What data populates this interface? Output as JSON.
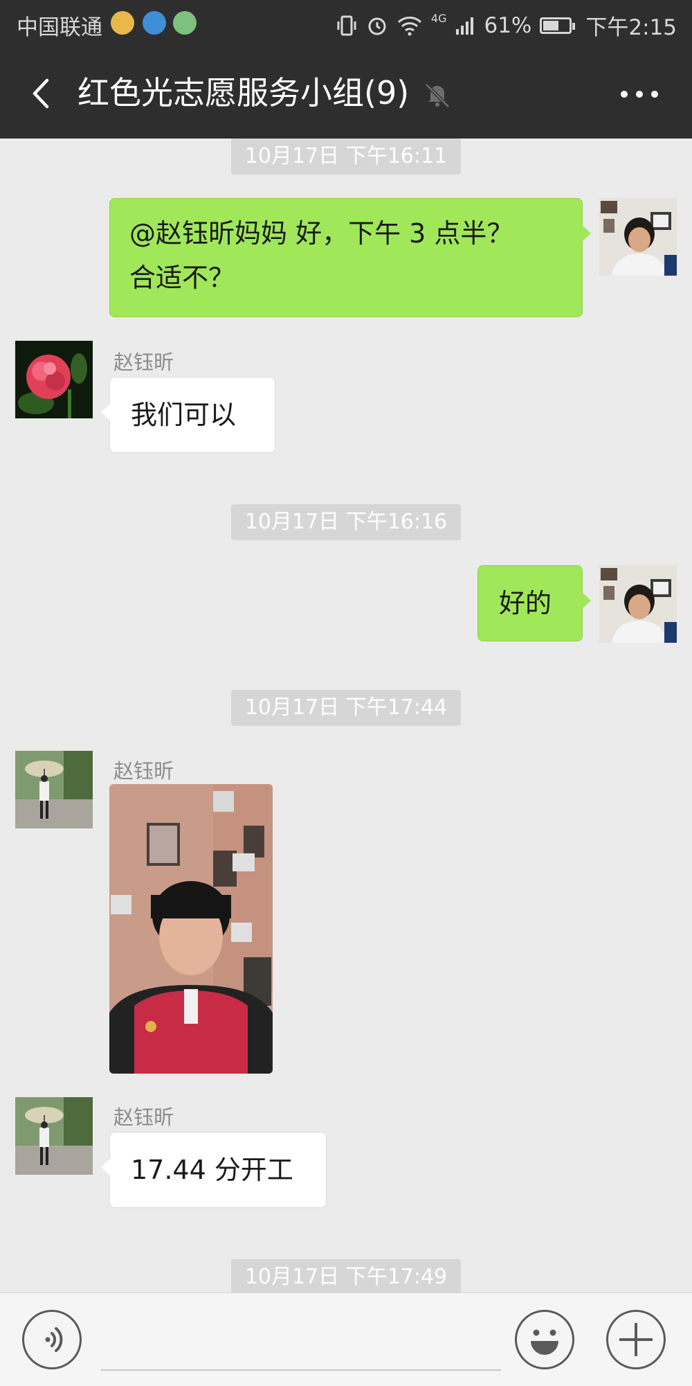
{
  "status_bar": {
    "carrier": "中国联通",
    "battery_percent": "61%",
    "battery_level": 0.61,
    "network": "4G",
    "time": "下午2:15",
    "icons": [
      "notification-icon",
      "qq-icon",
      "app-icon",
      "vibrate-icon",
      "alarm-icon",
      "wifi-icon",
      "signal-icon",
      "battery-icon"
    ]
  },
  "header": {
    "title": "红色光志愿服务小组(9)",
    "icons": [
      "back-icon",
      "mute-icon",
      "more-icon"
    ]
  },
  "messages": [
    {
      "type": "timestamp",
      "text": "10月17日 下午16:11"
    },
    {
      "type": "out",
      "text_line1": "@赵钰昕妈妈  好，下午 3 点半？",
      "text_line2": "合适不？"
    },
    {
      "type": "in",
      "sender": "赵钰昕",
      "text": "我们可以"
    },
    {
      "type": "timestamp",
      "text": "10月17日 下午16:16"
    },
    {
      "type": "out",
      "text": "好的"
    },
    {
      "type": "timestamp",
      "text": "10月17日 下午17:44"
    },
    {
      "type": "in-image",
      "sender": "赵钰昕"
    },
    {
      "type": "in",
      "sender": "赵钰昕",
      "text": "17.44 分开工"
    },
    {
      "type": "timestamp",
      "text": "10月17日 下午17:49"
    }
  ],
  "input_bar": {
    "placeholder": "",
    "icons": [
      "voice-icon",
      "emoji-icon",
      "plus-icon"
    ]
  },
  "colors": {
    "bar_bg": "#2e2e2e",
    "chat_bg": "#ebebeb",
    "out_bubble": "#a0e75a",
    "in_bubble": "#ffffff",
    "timestamp_bg": "#d6d6d6"
  }
}
